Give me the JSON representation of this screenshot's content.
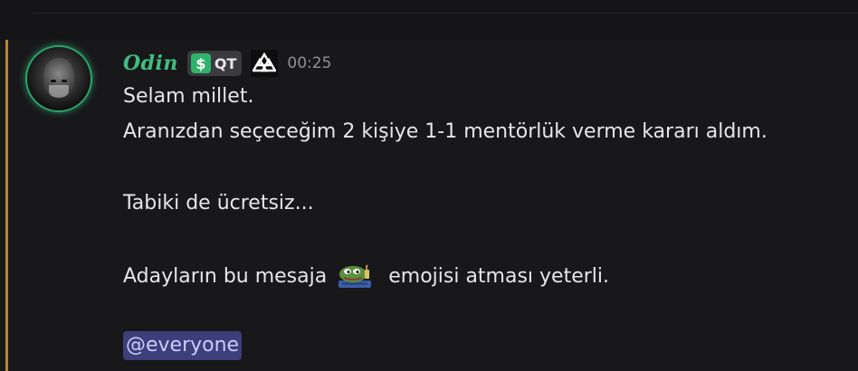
{
  "message": {
    "author": "Odin",
    "role_tag": "QT",
    "timestamp": "00:25",
    "lines": [
      "Selam millet.",
      "Aranızdan seçeceğim 2 kişiye 1-1 mentörlük verme kararı aldım.",
      "Tabiki de ücretsiz...",
      "Adayların bu mesaja",
      "emojisi atması yeterli."
    ],
    "mention": "@everyone",
    "emoji_name": "pepe-emoji"
  },
  "icons": {
    "role_icon": "dollar-icon",
    "badge_icon": "valknut-icon"
  },
  "colors": {
    "username": "#3fbf7f",
    "highlight_bar": "#b5892e",
    "mention_bg": "#3c3f7a",
    "mention_text": "#c9cdfb",
    "role_icon_bg": "#2fb36b"
  }
}
